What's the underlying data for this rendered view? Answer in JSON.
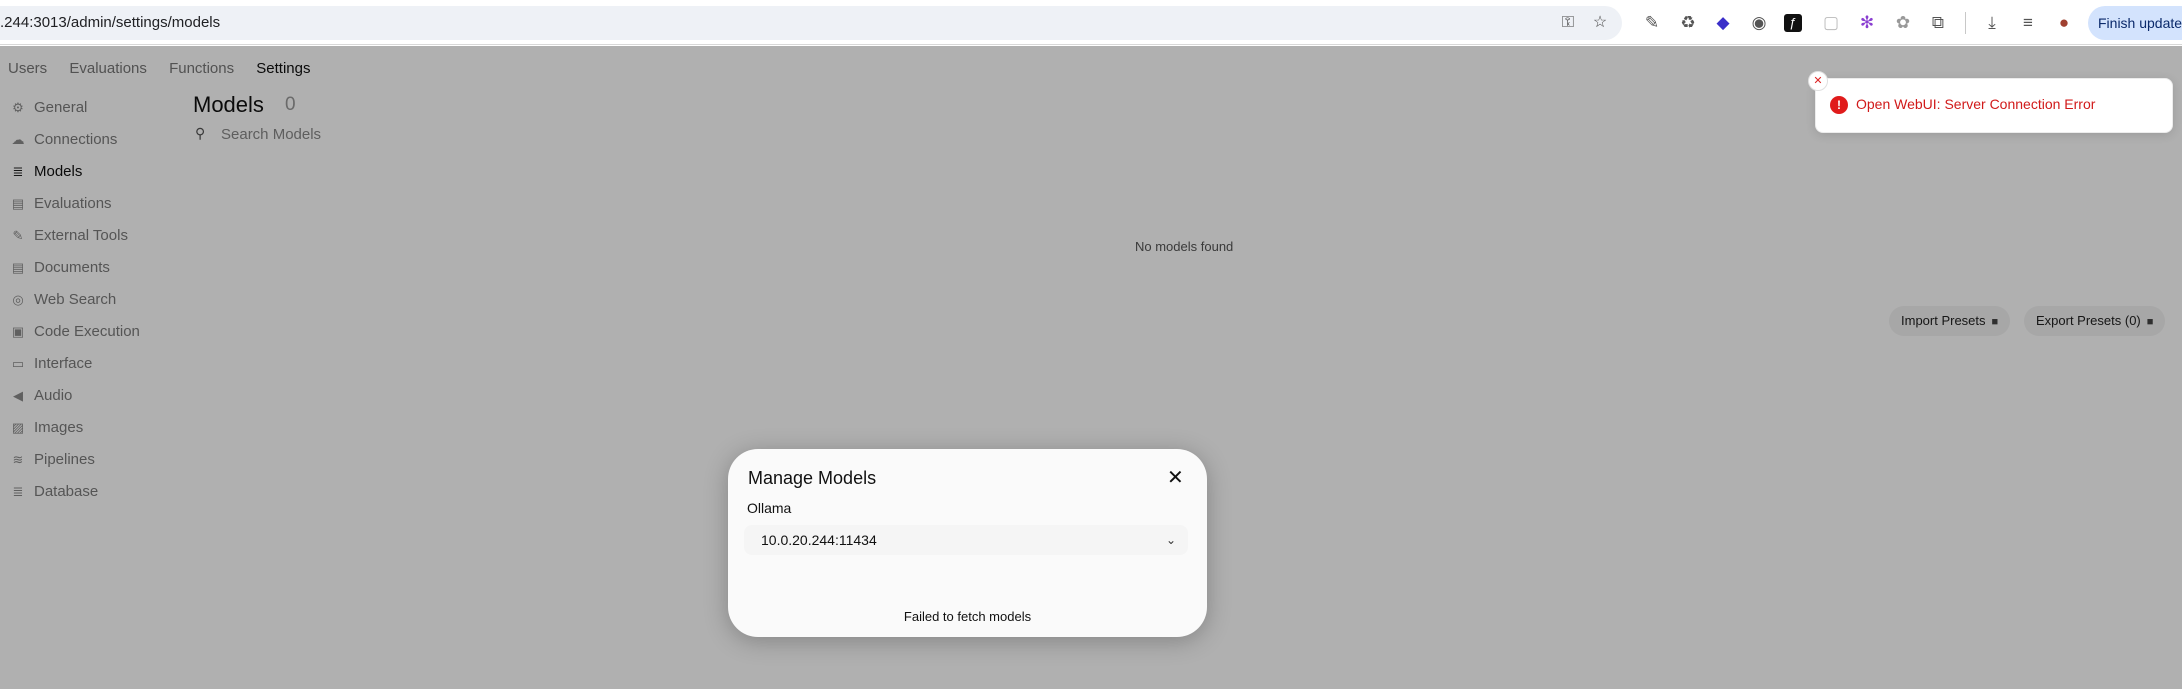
{
  "browser": {
    "url": ".244:3013/admin/settings/models",
    "finish_update_label": "Finish update",
    "omnibox_icons": [
      "key-icon",
      "star-icon"
    ],
    "extension_icons": [
      "eyedropper-icon",
      "recycle-icon",
      "stack-icon",
      "camera-icon",
      "font-icon",
      "square-icon",
      "gear-icon",
      "chatgpt-icon",
      "puzzle-icon",
      "download-icon",
      "media-queue-icon",
      "avatar-icon"
    ]
  },
  "topnav": {
    "items": [
      {
        "label": "Users"
      },
      {
        "label": "Evaluations"
      },
      {
        "label": "Functions"
      },
      {
        "label": "Settings"
      }
    ]
  },
  "sidebar": {
    "items": [
      {
        "label": "General",
        "icon": "gear-icon"
      },
      {
        "label": "Connections",
        "icon": "cloud-icon"
      },
      {
        "label": "Models",
        "icon": "database-icon"
      },
      {
        "label": "Evaluations",
        "icon": "document-icon"
      },
      {
        "label": "External Tools",
        "icon": "wrench-icon"
      },
      {
        "label": "Documents",
        "icon": "document-icon"
      },
      {
        "label": "Web Search",
        "icon": "globe-icon"
      },
      {
        "label": "Code Execution",
        "icon": "terminal-icon"
      },
      {
        "label": "Interface",
        "icon": "monitor-icon"
      },
      {
        "label": "Audio",
        "icon": "speaker-icon"
      },
      {
        "label": "Images",
        "icon": "image-icon"
      },
      {
        "label": "Pipelines",
        "icon": "stack-icon"
      },
      {
        "label": "Database",
        "icon": "database-icon"
      }
    ]
  },
  "main": {
    "title": "Models",
    "count": "0",
    "search_placeholder": "Search Models",
    "empty_text": "No models found",
    "import_label": "Import Presets",
    "export_label": "Export Presets (0)"
  },
  "modal": {
    "title": "Manage Models",
    "provider_label": "Ollama",
    "selected_endpoint": "10.0.20.244:11434",
    "status_text": "Failed to fetch models"
  },
  "toast": {
    "message": "Open WebUI: Server Connection Error",
    "color": "#d11a1a"
  }
}
